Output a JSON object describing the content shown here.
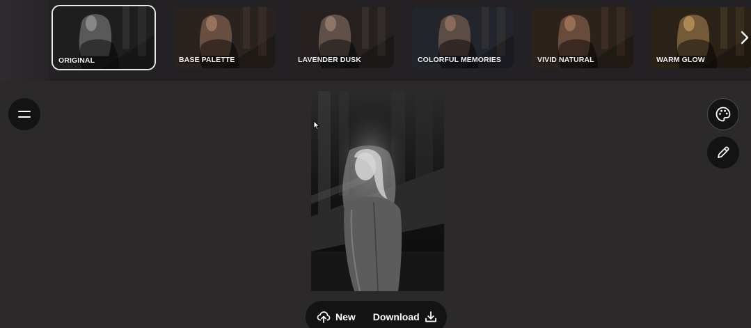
{
  "filters": [
    {
      "label": "ORIGINAL",
      "selected": true,
      "tint": "#8a8a8a",
      "dark": "#1e1e1e"
    },
    {
      "label": "BASE PALETTE",
      "selected": false,
      "tint": "#9a7560",
      "dark": "#2a221e"
    },
    {
      "label": "LAVENDER DUSK",
      "selected": false,
      "tint": "#8f7868",
      "dark": "#262120"
    },
    {
      "label": "COLORFUL MEMORIES",
      "selected": false,
      "tint": "#8c6d5c",
      "dark": "#22252b"
    },
    {
      "label": "VIVID NATURAL",
      "selected": false,
      "tint": "#9b7055",
      "dark": "#2b221b"
    },
    {
      "label": "WARM GLOW",
      "selected": false,
      "tint": "#b08a55",
      "dark": "#2a2117"
    }
  ],
  "icons": {
    "next": "chevron-right-icon",
    "menu": "menu-icon",
    "palette": "palette-icon",
    "edit": "pencil-icon",
    "upload": "cloud-upload-icon",
    "download": "download-icon"
  },
  "actions": {
    "new_label": "New",
    "download_label": "Download"
  },
  "colors": {
    "background": "#2b292a",
    "strip": "#232123",
    "button": "#141314",
    "text": "#ffffff"
  }
}
